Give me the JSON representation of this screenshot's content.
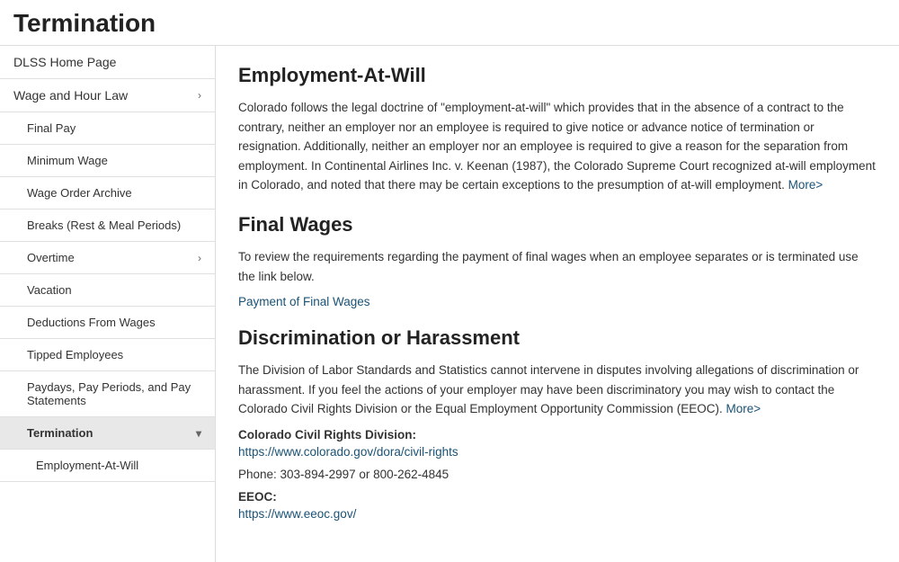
{
  "page_title": "Termination",
  "sidebar": {
    "items": [
      {
        "id": "dlss-home",
        "label": "DLSS Home Page",
        "level": "top",
        "active": false,
        "has_arrow": false
      },
      {
        "id": "wage-hour-law",
        "label": "Wage and Hour Law",
        "level": "top",
        "active": false,
        "has_arrow": true
      },
      {
        "id": "final-pay",
        "label": "Final Pay",
        "level": "sub",
        "active": false,
        "has_arrow": false
      },
      {
        "id": "minimum-wage",
        "label": "Minimum Wage",
        "level": "sub",
        "active": false,
        "has_arrow": false
      },
      {
        "id": "wage-order-archive",
        "label": "Wage Order Archive",
        "level": "sub",
        "active": false,
        "has_arrow": false
      },
      {
        "id": "breaks",
        "label": "Breaks (Rest & Meal Periods)",
        "level": "sub",
        "active": false,
        "has_arrow": false
      },
      {
        "id": "overtime",
        "label": "Overtime",
        "level": "sub",
        "active": false,
        "has_arrow": true
      },
      {
        "id": "vacation",
        "label": "Vacation",
        "level": "sub",
        "active": false,
        "has_arrow": false
      },
      {
        "id": "deductions",
        "label": "Deductions From Wages",
        "level": "sub",
        "active": false,
        "has_arrow": false
      },
      {
        "id": "tipped-employees",
        "label": "Tipped Employees",
        "level": "sub",
        "active": false,
        "has_arrow": false
      },
      {
        "id": "paydays",
        "label": "Paydays, Pay Periods, and Pay Statements",
        "level": "sub",
        "active": false,
        "has_arrow": false
      },
      {
        "id": "termination",
        "label": "Termination",
        "level": "sub",
        "active": true,
        "has_arrow": true
      },
      {
        "id": "employment-at-will-sub",
        "label": "Employment-At-Will",
        "level": "subsub",
        "active": false,
        "has_arrow": false
      }
    ]
  },
  "main": {
    "sections": [
      {
        "id": "employment-at-will",
        "title": "Employment-At-Will",
        "body": "Colorado follows the legal doctrine of \"employment-at-will\" which provides that in the absence of a contract to the contrary, neither an employer nor an employee is required to give notice or advance notice of termination or resignation. Additionally, neither an employer nor an employee is required to give a reason for the separation from employment. In Continental Airlines Inc. v. Keenan (1987), the Colorado Supreme Court recognized at-will employment in Colorado, and noted that there may be certain exceptions to the presumption of at-will employment.",
        "link_text": "More>",
        "link_url": "#"
      },
      {
        "id": "final-wages",
        "title": "Final Wages",
        "body": "To review the requirements regarding the payment of final wages when an employee separates or is terminated use the link below.",
        "link_text": "Payment of Final Wages",
        "link_url": "#"
      },
      {
        "id": "discrimination-harassment",
        "title": "Discrimination or Harassment",
        "body": "The Division of Labor Standards and Statistics cannot intervene in disputes involving allegations of discrimination or harassment. If you feel the actions of your employer may have been discriminatory you may wish to contact the Colorado Civil Rights Division or the Equal Employment Opportunity Commission (EEOC).",
        "link_text": "More>",
        "link_url": "#",
        "subsections": [
          {
            "id": "civil-rights",
            "label": "Colorado Civil Rights Division:",
            "url": "https://www.colorado.gov/dora/civil-rights",
            "phone": "Phone: 303-894-2997 or 800-262-4845"
          },
          {
            "id": "eeoc",
            "label": "EEOC:",
            "url": "https://www.eeoc.gov/"
          }
        ]
      }
    ]
  }
}
